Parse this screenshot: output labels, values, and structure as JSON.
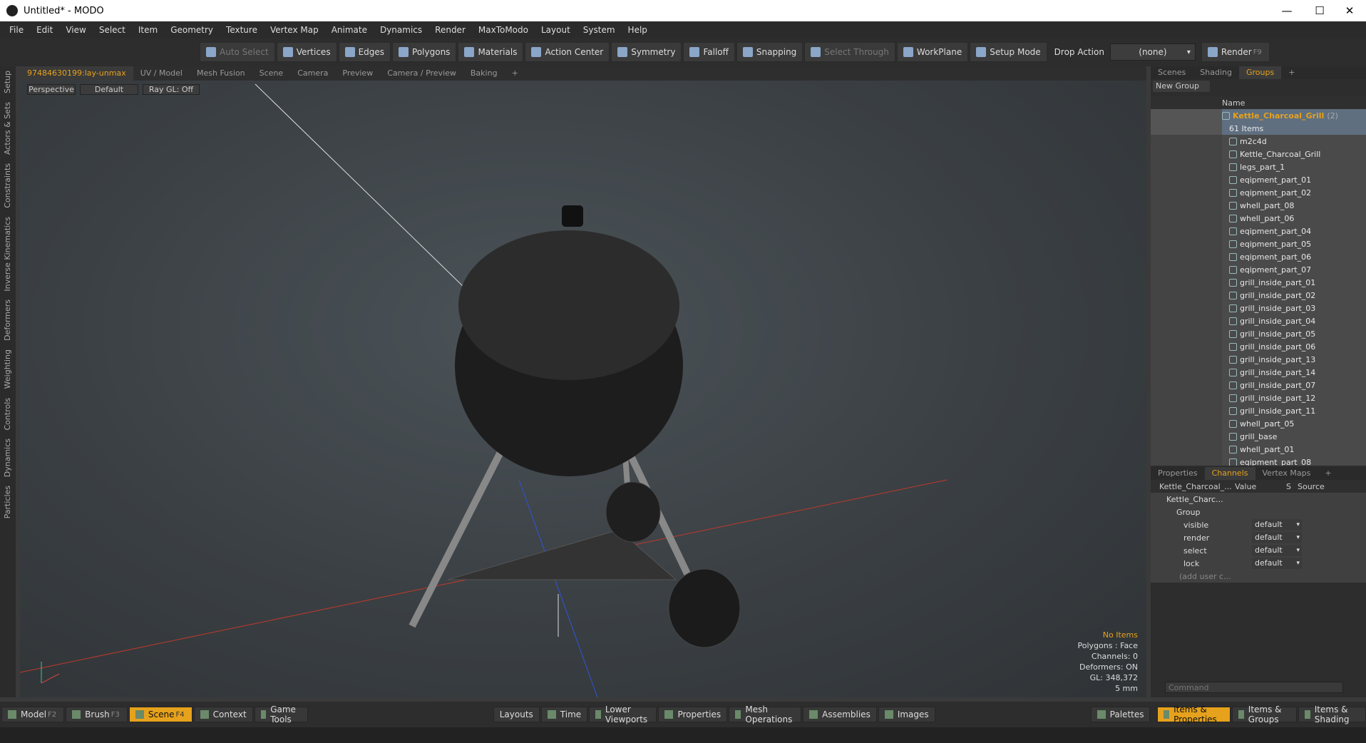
{
  "window": {
    "title": "Untitled* - MODO",
    "minimize": "—",
    "maximize": "☐",
    "close": "✕"
  },
  "menu": [
    "File",
    "Edit",
    "View",
    "Select",
    "Item",
    "Geometry",
    "Texture",
    "Vertex Map",
    "Animate",
    "Dynamics",
    "Render",
    "MaxToModo",
    "Layout",
    "System",
    "Help"
  ],
  "toolbar": {
    "auto_select": "Auto Select",
    "vertices": "Vertices",
    "edges": "Edges",
    "polygons": "Polygons",
    "materials": "Materials",
    "action_center": "Action Center",
    "symmetry": "Symmetry",
    "falloff": "Falloff",
    "snapping": "Snapping",
    "select_through": "Select Through",
    "workplane": "WorkPlane",
    "setup_mode": "Setup Mode",
    "drop_action": "Drop Action",
    "drop_value": "(none)",
    "render": "Render",
    "render_key": "F9"
  },
  "left_tabs": [
    "Setup",
    "Actors & Sets",
    "Constraints",
    "Inverse Kinematics",
    "Deformers",
    "Weighting",
    "Controls",
    "Dynamics",
    "Particles"
  ],
  "viewport_tabs": [
    "97484630199:lay-unmax",
    "UV / Model",
    "Mesh Fusion",
    "Scene",
    "Camera",
    "Preview",
    "Camera / Preview",
    "Baking",
    "+"
  ],
  "viewport": {
    "perspective": "Perspective",
    "shading": "Default",
    "raygl": "Ray GL: Off",
    "info": {
      "items": "No Items",
      "polygons": "Polygons : Face",
      "channels": "Channels: 0",
      "deformers": "Deformers: ON",
      "gl": "GL: 348,372",
      "scale": "5 mm"
    }
  },
  "right_tabs": [
    "Scenes",
    "Shading",
    "Groups",
    "+"
  ],
  "groups": {
    "new_group": "New Group",
    "name_col": "Name",
    "root": {
      "name": "Kettle_Charcoal_Grill",
      "count": "(2)",
      "items": "61 Items"
    },
    "items": [
      "m2c4d",
      "Kettle_Charcoal_Grill",
      "legs_part_1",
      "eqipment_part_01",
      "eqipment_part_02",
      "whell_part_08",
      "whell_part_06",
      "eqipment_part_04",
      "eqipment_part_05",
      "eqipment_part_06",
      "eqipment_part_07",
      "grill_inside_part_01",
      "grill_inside_part_02",
      "grill_inside_part_03",
      "grill_inside_part_04",
      "grill_inside_part_05",
      "grill_inside_part_06",
      "grill_inside_part_13",
      "grill_inside_part_14",
      "grill_inside_part_07",
      "grill_inside_part_12",
      "grill_inside_part_11",
      "whell_part_05",
      "grill_base",
      "whell_part_01",
      "eqipment_part_08"
    ]
  },
  "props_tabs": [
    "Properties",
    "Channels",
    "Vertex Maps",
    "+"
  ],
  "channels": {
    "head": {
      "name": "Kettle_Charcoal_...",
      "value": "Value",
      "s": "S",
      "source": "Source"
    },
    "root": "Kettle_Charc...",
    "group": "Group",
    "rows": [
      {
        "name": "visible",
        "value": "default"
      },
      {
        "name": "render",
        "value": "default"
      },
      {
        "name": "select",
        "value": "default"
      },
      {
        "name": "lock",
        "value": "default"
      }
    ],
    "add": "(add user c..."
  },
  "command": {
    "placeholder": "Command"
  },
  "bottom": {
    "model": "Model",
    "model_key": "F2",
    "brush": "Brush",
    "brush_key": "F3",
    "scene": "Scene",
    "scene_key": "F4",
    "context": "Context",
    "game_tools": "Game Tools",
    "layouts": "Layouts",
    "time": "Time",
    "lower_viewports": "Lower Viewports",
    "properties": "Properties",
    "mesh_ops": "Mesh Operations",
    "assemblies": "Assemblies",
    "images": "Images",
    "palettes": "Palettes",
    "items_props": "Items & Properties",
    "items_groups": "Items & Groups",
    "items_shading": "Items & Shading"
  }
}
